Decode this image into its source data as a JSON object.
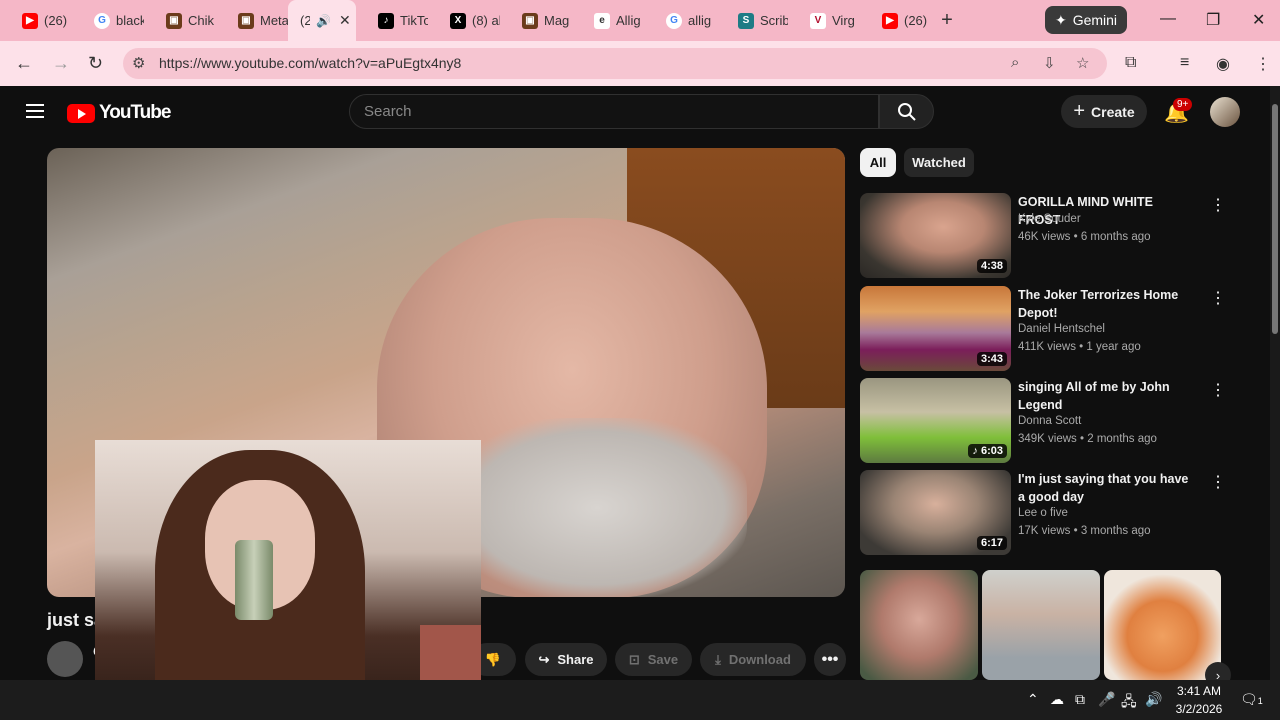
{
  "browser": {
    "tabs": [
      {
        "title": "(26)",
        "favicon": "youtube-icon",
        "color": "#ff0000"
      },
      {
        "title": "black",
        "favicon": "google-icon",
        "color": "#4285f4"
      },
      {
        "title": "Chik",
        "favicon": "bookmark-icon",
        "color": "#6b3b1b"
      },
      {
        "title": "Meta",
        "favicon": "bookmark-icon",
        "color": "#6b3b1b"
      },
      {
        "title": "(2",
        "favicon": "speaker-icon",
        "color": "#333333"
      },
      {
        "title": "TikTo",
        "favicon": "tiktok-icon",
        "color": "#000000"
      },
      {
        "title": "(8) al",
        "favicon": "x-icon",
        "color": "#000000"
      },
      {
        "title": "Mag",
        "favicon": "bookmark-icon",
        "color": "#6b3b1b"
      },
      {
        "title": "Allig",
        "favicon": "e-icon",
        "color": "#555555"
      },
      {
        "title": "allig",
        "favicon": "google-icon",
        "color": "#4285f4"
      },
      {
        "title": "Scrib",
        "favicon": "scribd-icon",
        "color": "#1e7b85"
      },
      {
        "title": "Virg",
        "favicon": "v-icon",
        "color": "#b10d2c"
      },
      {
        "title": "(26)",
        "favicon": "youtube-icon",
        "color": "#ff0000"
      }
    ],
    "gemini_label": "Gemini",
    "url": "https://www.youtube.com/watch?v=aPuEgtx4ny8"
  },
  "youtube": {
    "logo_text": "YouTube",
    "search_placeholder": "Search",
    "create_label": "Create",
    "notification_badge": "9+",
    "chips": [
      "All",
      "Watched"
    ],
    "video": {
      "title": "just sayi",
      "channel": "Co",
      "share_label": "Share",
      "save_label": "Save",
      "download_label": "Download"
    },
    "recommendations": [
      {
        "title": "GORILLA MIND WHITE FROST",
        "channel": "Kyle Souder",
        "views": "46K views",
        "age": "6 months ago",
        "duration": "4:38"
      },
      {
        "title": "The Joker Terrorizes Home Depot!",
        "channel": "Daniel Hentschel",
        "views": "411K views",
        "age": "1 year ago",
        "duration": "3:43"
      },
      {
        "title": "singing All of me by John Legend",
        "channel": "Donna Scott",
        "views": "349K views",
        "age": "2 months ago",
        "duration": "♪ 6:03"
      },
      {
        "title": "I'm just saying that you have a good day",
        "channel": "Lee o five",
        "views": "17K views",
        "age": "3 months ago",
        "duration": "6:17"
      }
    ]
  },
  "taskbar": {
    "time": "3:41 AM",
    "date": "3/2/2026",
    "notification_count": "1"
  }
}
